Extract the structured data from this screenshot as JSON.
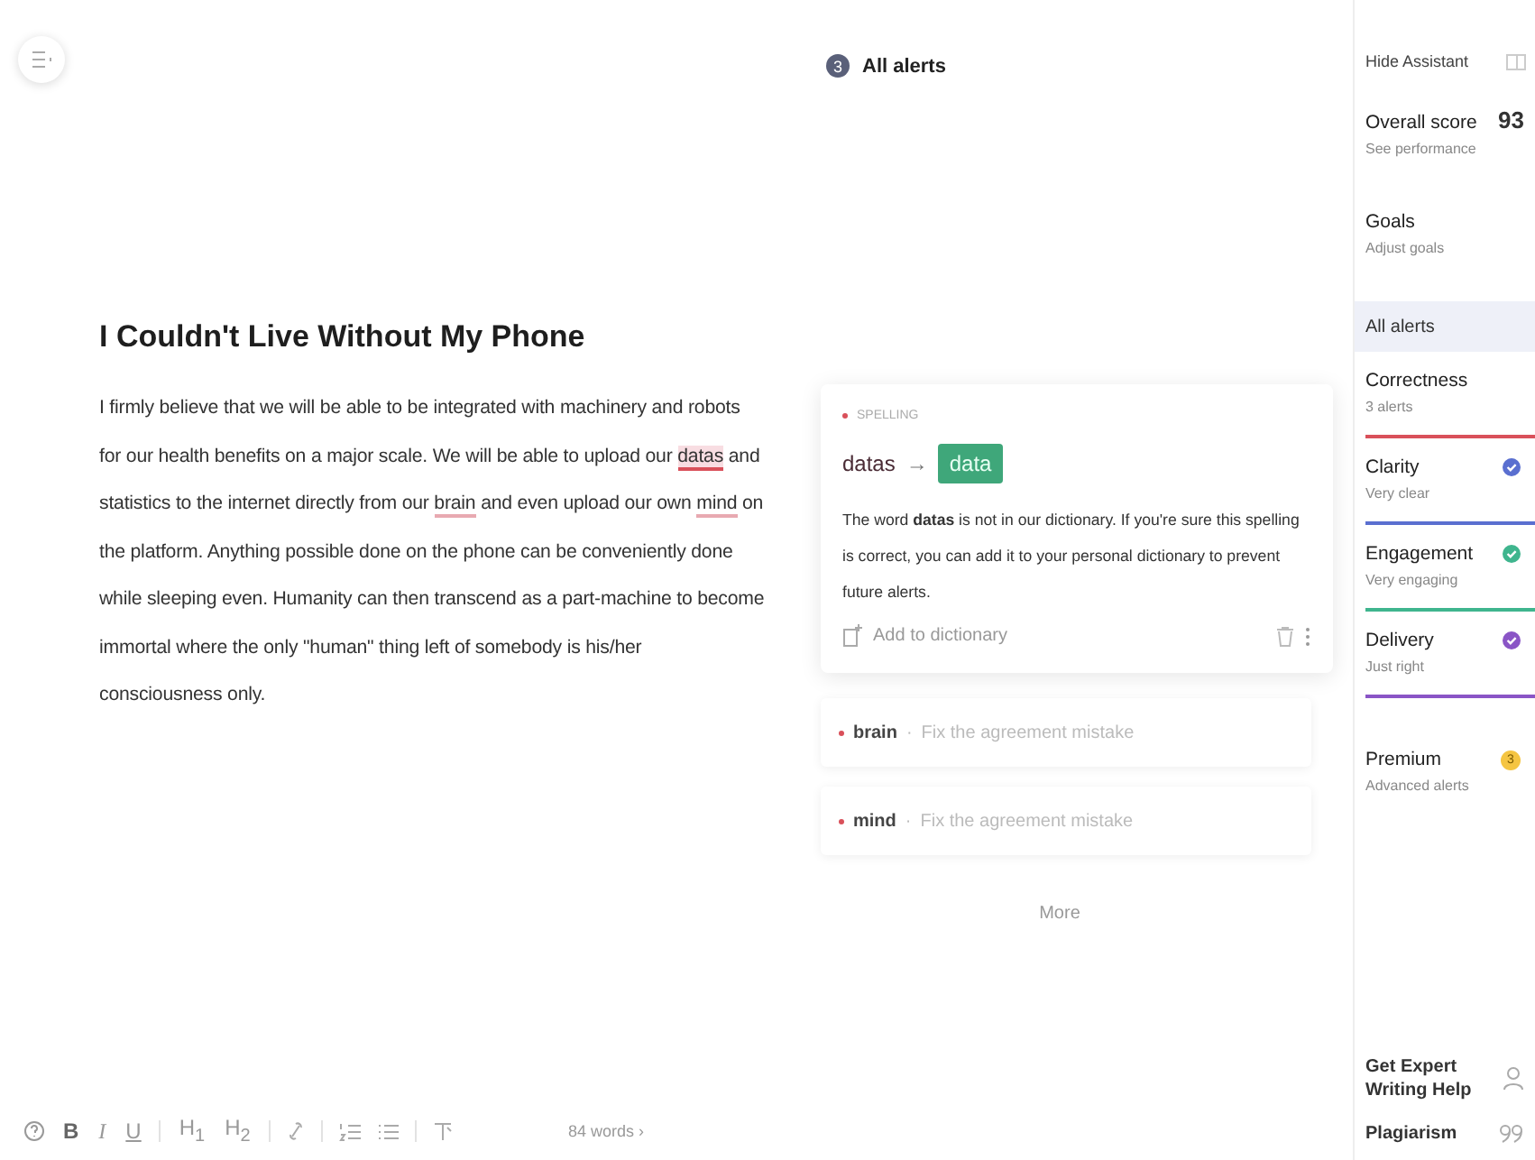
{
  "editor": {
    "title": "I Couldn't Live Without My Phone",
    "paragraph": [
      {
        "text": "I firmly believe that we will be able to be integrated with machinery and robots for our health benefits on a major scale. We will be able to upload our ",
        "kind": "plain"
      },
      {
        "text": "datas",
        "kind": "active"
      },
      {
        "text": " and statistics to the internet directly from our ",
        "kind": "plain"
      },
      {
        "text": "brain",
        "kind": "issue"
      },
      {
        "text": " and even upload our own ",
        "kind": "plain"
      },
      {
        "text": "mind",
        "kind": "issue"
      },
      {
        "text": " on the platform. Anything possible done on the phone can be conveniently done while sleeping even. Humanity can then transcend as a part-machine to become immortal where the only \"human\" thing left of somebody is his/her consciousness only.",
        "kind": "plain"
      }
    ]
  },
  "toolbar": {
    "buttons": [
      {
        "kind": "help"
      },
      {
        "kind": "bold",
        "label": "B"
      },
      {
        "kind": "italic",
        "label": "I"
      },
      {
        "kind": "underline",
        "label": "U"
      },
      {
        "kind": "sep"
      },
      {
        "kind": "heading",
        "label": "H$_{1}$"
      },
      {
        "kind": "heading",
        "label": "H$_{2}$"
      },
      {
        "kind": "sep"
      },
      {
        "kind": "link"
      },
      {
        "kind": "sep"
      },
      {
        "kind": "ordered-list"
      },
      {
        "kind": "bullet-list"
      },
      {
        "kind": "sep"
      },
      {
        "kind": "clear-format"
      }
    ],
    "word_count": "84 words ›"
  },
  "alerts": {
    "count": "3",
    "title": "All alerts",
    "card": {
      "category": "SPELLING",
      "wrong": "datas",
      "arrow": "→",
      "suggestion": "data",
      "description": "The word **datas** is not in our dictionary. If you're sure this spelling is correct, you can add it to your personal dictionary to prevent future alerts.",
      "action": "Add to dictionary"
    },
    "items": [
      {
        "word": "brain",
        "separator": "·",
        "hint": "Fix the agreement mistake"
      },
      {
        "word": "mind",
        "separator": "·",
        "hint": "Fix the agreement mistake"
      }
    ],
    "more": "More"
  },
  "sidebar": {
    "hide": "Hide Assistant",
    "score": {
      "label": "Overall score",
      "value": "93",
      "sub": "See performance"
    },
    "goals": {
      "label": "Goals",
      "sub": "Adjust goals"
    },
    "all_alerts": {
      "label": "All alerts",
      "selected": true
    },
    "categories": [
      {
        "name": "Correctness",
        "sub": "3 alerts",
        "color": "#d9505a",
        "kind": "plain"
      },
      {
        "name": "Clarity",
        "sub": "Very clear",
        "color": "#5a6fd0",
        "kind": "checked"
      },
      {
        "name": "Engagement",
        "sub": "Very engaging",
        "color": "#3fb58e",
        "kind": "checked"
      },
      {
        "name": "Delivery",
        "sub": "Just right",
        "color": "#8a55c6",
        "kind": "checked"
      }
    ],
    "premium": {
      "name": "Premium",
      "sub": "Advanced alerts",
      "count": "3"
    },
    "expert": "Get Expert Writing Help",
    "plagiarism": "Plagiarism"
  }
}
